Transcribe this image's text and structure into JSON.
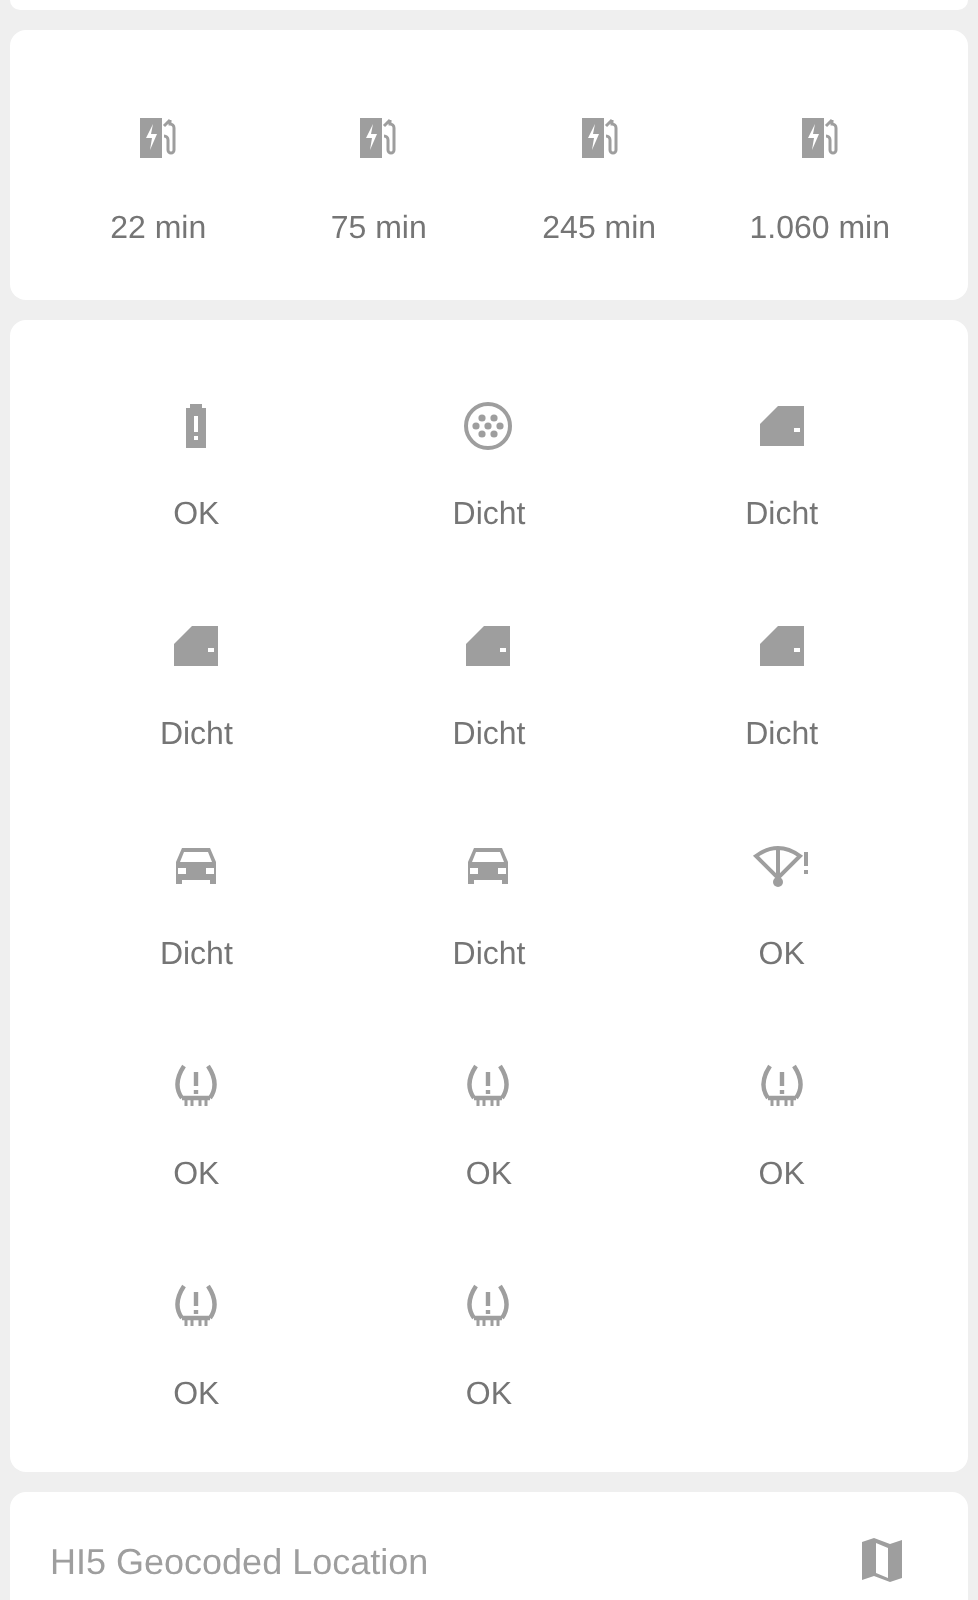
{
  "charging_times": [
    {
      "label": "22 min"
    },
    {
      "label": "75 min"
    },
    {
      "label": "245 min"
    },
    {
      "label": "1.060 min"
    }
  ],
  "status_items": [
    {
      "kind": "battery",
      "label": "OK"
    },
    {
      "kind": "plug",
      "label": "Dicht"
    },
    {
      "kind": "door",
      "label": "Dicht"
    },
    {
      "kind": "door",
      "label": "Dicht"
    },
    {
      "kind": "door",
      "label": "Dicht"
    },
    {
      "kind": "door",
      "label": "Dicht"
    },
    {
      "kind": "car",
      "label": "Dicht"
    },
    {
      "kind": "car",
      "label": "Dicht"
    },
    {
      "kind": "wiper",
      "label": "OK"
    },
    {
      "kind": "tire",
      "label": "OK"
    },
    {
      "kind": "tire",
      "label": "OK"
    },
    {
      "kind": "tire",
      "label": "OK"
    },
    {
      "kind": "tire",
      "label": "OK"
    },
    {
      "kind": "tire",
      "label": "OK"
    }
  ],
  "location_card": {
    "title": "HI5 Geocoded Location"
  }
}
